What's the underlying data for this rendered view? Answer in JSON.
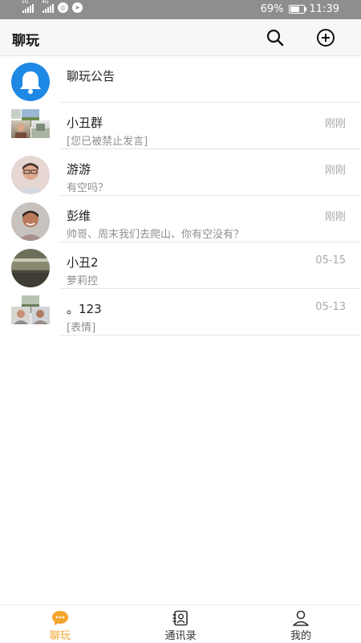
{
  "status_bar": {
    "signal1": "5G",
    "signal2": "4G",
    "battery_percent": "69%",
    "battery_level": 0.69,
    "time": "11:39"
  },
  "header": {
    "title": "聊玩",
    "search_icon": "search-icon",
    "add_icon": "add-circle-icon"
  },
  "chats": [
    {
      "name": "聊玩公告",
      "preview": "",
      "time": "",
      "avatar": "bell-icon",
      "avatar_color": "#1e88e5"
    },
    {
      "name": "小丑群",
      "preview": "[您已被禁止发言]",
      "time": "刚刚"
    },
    {
      "name": "游游",
      "preview": "有空吗？",
      "time": "刚刚"
    },
    {
      "name": "彭维",
      "preview": "帅哥、周末我们去爬山、你有空没有？",
      "time": "刚刚"
    },
    {
      "name": "小丑2",
      "preview": "萝莉控",
      "time": "05-15"
    },
    {
      "name": "。123",
      "preview": "[表情]",
      "time": "05-13"
    }
  ],
  "tabs": [
    {
      "label": "聊玩",
      "icon": "chat-bubble-icon",
      "active": true
    },
    {
      "label": "通讯录",
      "icon": "contacts-icon",
      "active": false
    },
    {
      "label": "我的",
      "icon": "person-icon",
      "active": false
    }
  ],
  "colors": {
    "accent": "#f3a52e",
    "status_bar": "#8e8e8e",
    "header_bg": "#f7f7f7",
    "notice_blue": "#1e88e5"
  }
}
